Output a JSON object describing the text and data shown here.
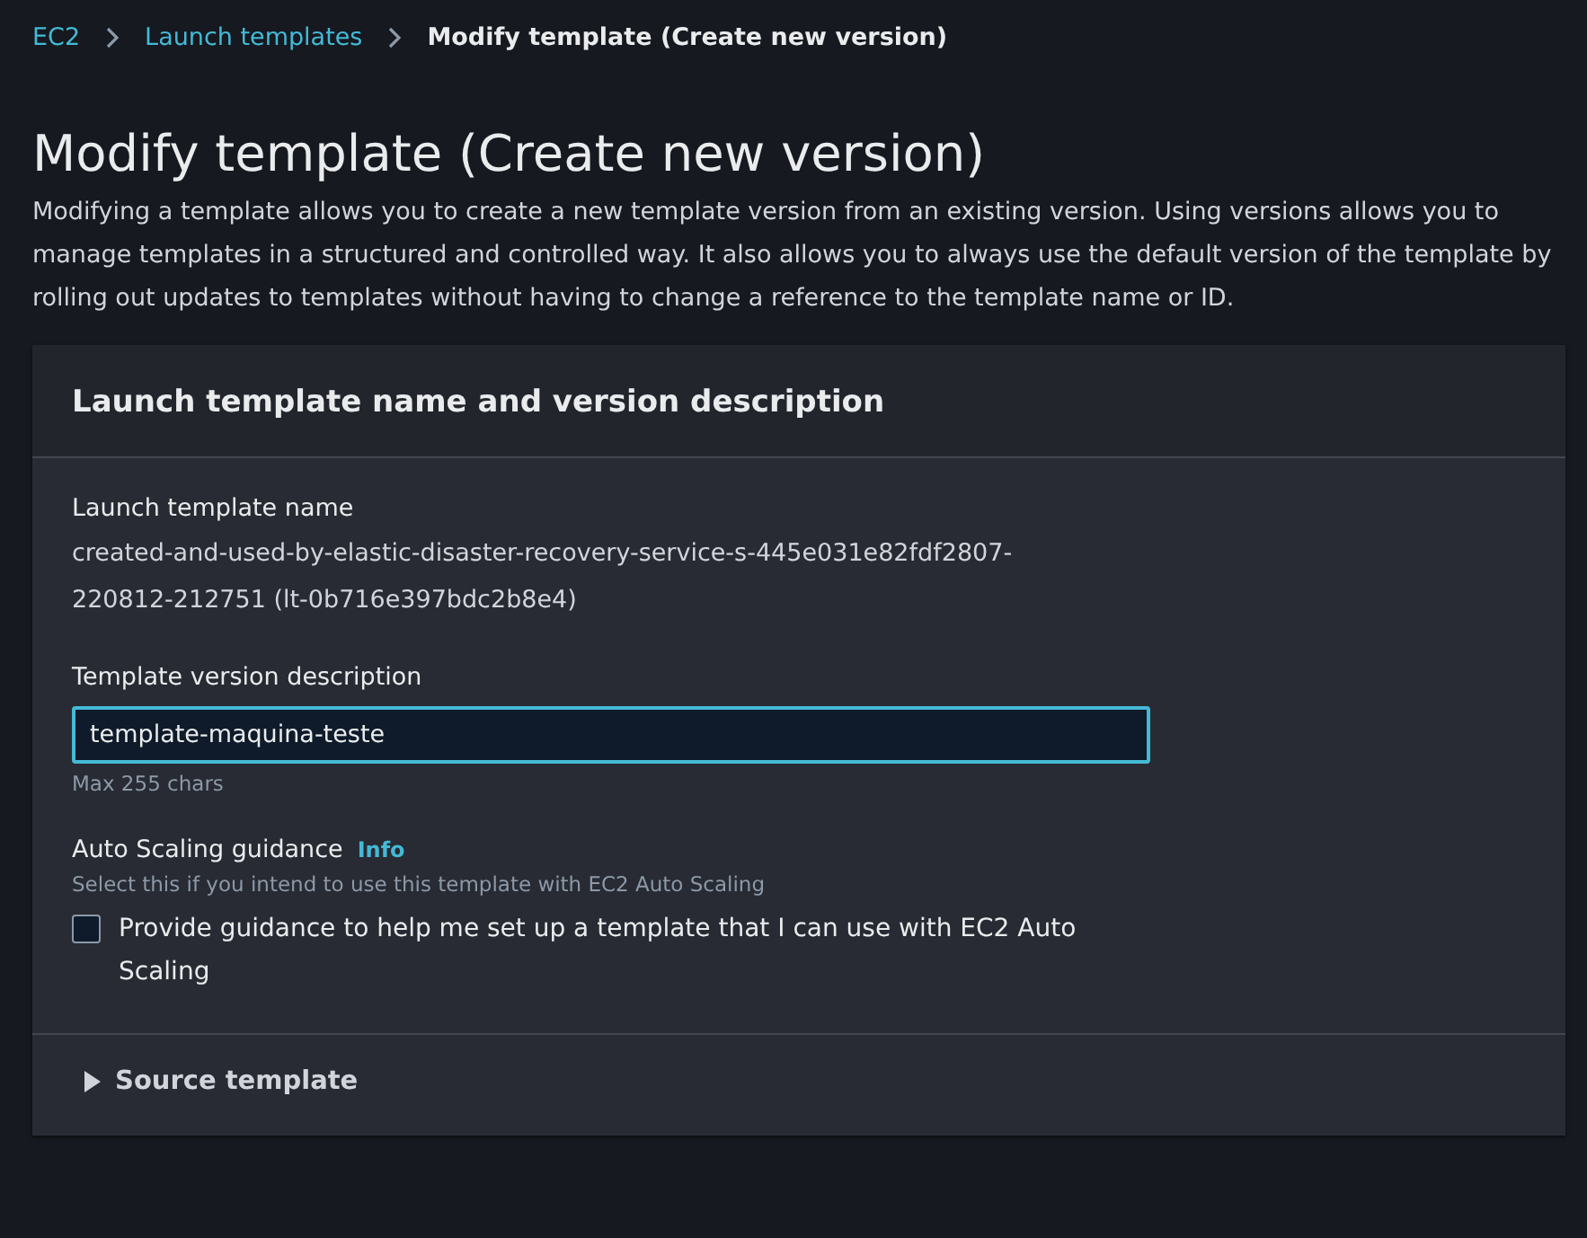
{
  "breadcrumbs": [
    {
      "label": "EC2",
      "kind": "link"
    },
    {
      "label": "Launch templates",
      "kind": "link"
    },
    {
      "label": "Modify template (Create new version)",
      "kind": "current"
    }
  ],
  "page": {
    "title": "Modify template (Create new version)",
    "description": "Modifying a template allows you to create a new template version from an existing version. Using versions allows you to manage templates in a structured and controlled way. It also allows you to always use the default version of the template by rolling out updates to templates without having to change a reference to the template name or ID."
  },
  "card": {
    "title": "Launch template name and version description",
    "name_field": {
      "label": "Launch template name",
      "value": "created-and-used-by-elastic-disaster-recovery-service-s-445e031e82fdf2807-220812-212751 (lt-0b716e397bdc2b8e4)"
    },
    "description_field": {
      "label": "Template version description",
      "value": "template-maquina-teste",
      "hint": "Max 255 chars"
    },
    "auto_scaling": {
      "label": "Auto Scaling guidance",
      "info": "Info",
      "hint": "Select this if you intend to use this template with EC2 Auto Scaling",
      "checkbox_label": "Provide guidance to help me set up a template that I can use with EC2 Auto Scaling",
      "checked": false
    },
    "source_template": {
      "label": "Source template",
      "expanded": false
    }
  }
}
